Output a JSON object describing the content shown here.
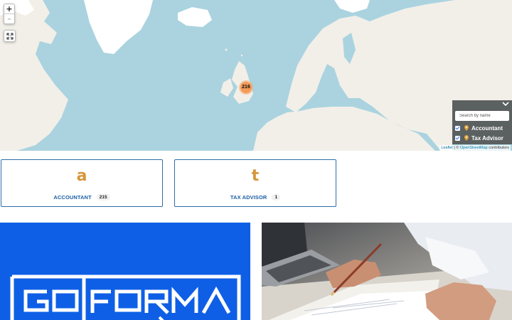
{
  "map": {
    "zoom_in_label": "+",
    "zoom_out_label": "–",
    "fullscreen_icon": "fullscreen-icon",
    "cluster": {
      "count": "216",
      "color": "#f49a59"
    },
    "layers": {
      "search_placeholder": "Search by name",
      "items": [
        {
          "label": "Accountant",
          "checked": true
        },
        {
          "label": "Tax Advisor",
          "checked": true
        }
      ]
    },
    "attribution": {
      "leaflet": "Leaflet",
      "separator": " | © ",
      "osm": "OpenStreetMap",
      "suffix": " contributors"
    },
    "colors": {
      "water": "#aad3df",
      "land": "#f2efe9",
      "ice": "#ffffff"
    }
  },
  "categories": [
    {
      "letter": "a",
      "name": "ACCOUNTANT",
      "count": "215"
    },
    {
      "letter": "t",
      "name": "TAX ADVISOR",
      "count": "1"
    }
  ],
  "colors": {
    "card_border": "#2e6ea8",
    "card_letter": "#d6963b",
    "card_name": "#1d5fa6",
    "banner_blue": "#0f5fe6"
  },
  "banners": {
    "left": {
      "logo_text": "GOFORMA"
    },
    "right": {
      "image": "laptop-paperwork-photo"
    }
  }
}
